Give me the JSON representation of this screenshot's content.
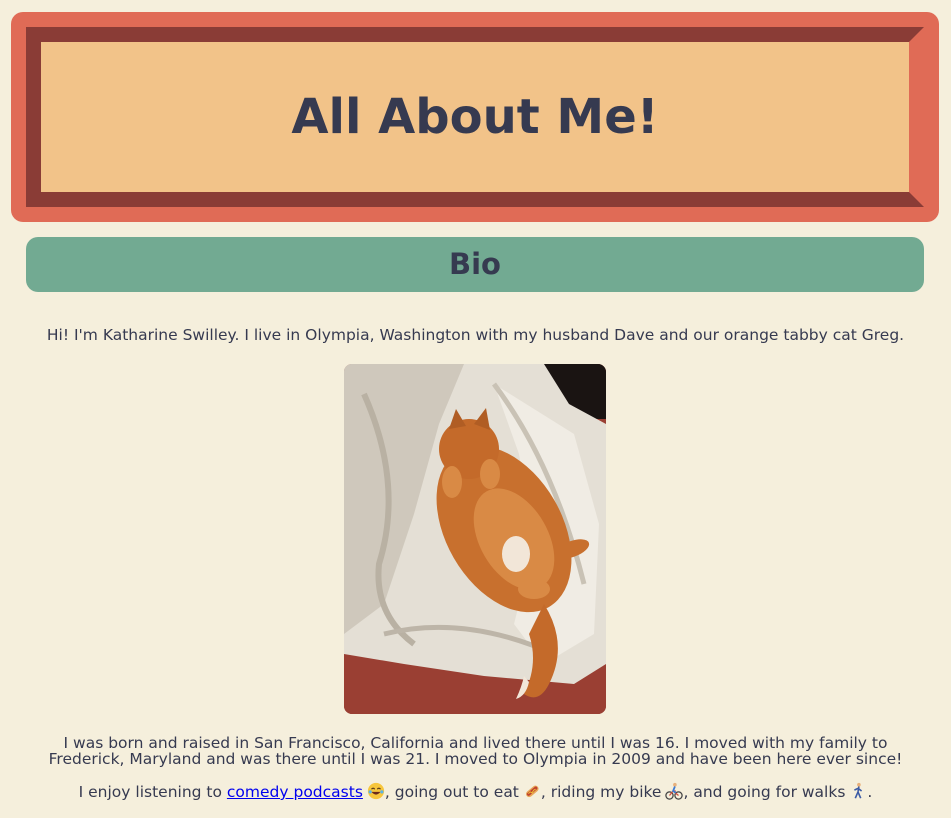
{
  "header": {
    "title": "All About Me!"
  },
  "bio_section": {
    "heading": "Bio",
    "intro": "Hi! I'm Katharine Swilley. I live in Olympia, Washington with my husband Dave and our orange tabby cat Greg.",
    "photo_icon": "cat-photo",
    "history": "I was born and raised in San Francisco, California and lived there until I was 16. I moved with my family to Frederick, Maryland and was there until I was 21. I moved to Olympia in 2009 and have been here ever since!",
    "hobbies": {
      "prefix": "I enjoy listening to ",
      "link_text": "comedy podcasts",
      "after_link": ", going out to eat",
      "after_food": ", riding my bike",
      "after_bike": ", and going for walks",
      "end": "."
    },
    "icons": [
      "laughing-emoji",
      "hotdog-emoji",
      "cyclist-emoji",
      "walking-emoji"
    ]
  },
  "colors": {
    "background": "#f5efdc",
    "header_frame": "#e06b56",
    "header_bevel": "#8a3c36",
    "header_fill": "#f2c389",
    "section_bar": "#72aa92",
    "text": "#363a50",
    "link": "#0000ee"
  }
}
